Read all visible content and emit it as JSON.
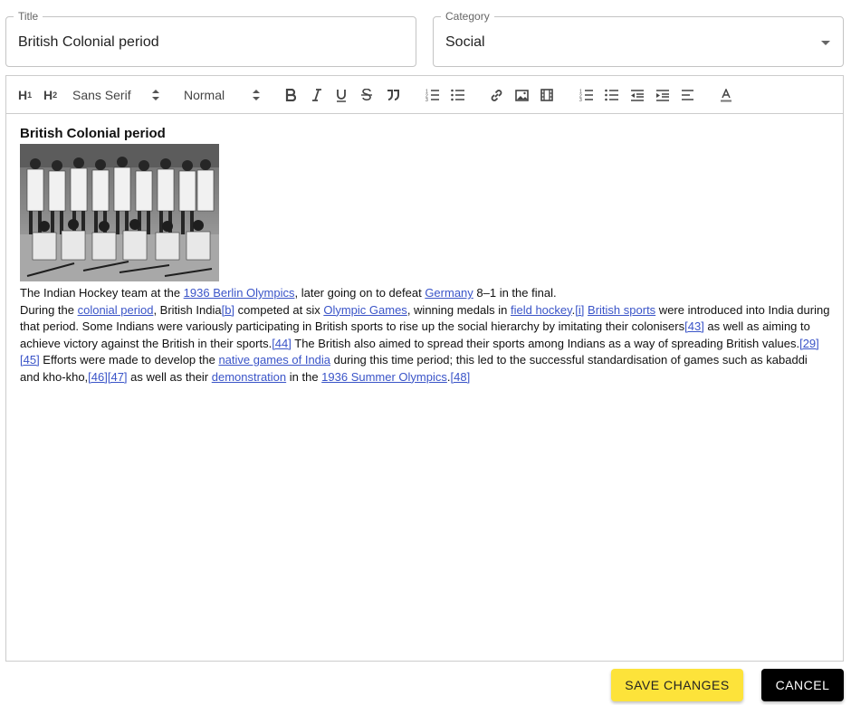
{
  "form": {
    "title_label": "Title",
    "title_value": "British Colonial period",
    "category_label": "Category",
    "category_value": "Social"
  },
  "toolbar": {
    "h1": "H",
    "h1_sub": "1",
    "h2": "H",
    "h2_sub": "2",
    "font_picker": "Sans Serif",
    "size_picker": "Normal"
  },
  "content": {
    "heading": "British Colonial period",
    "caption": {
      "t1": "The Indian Hockey team at the ",
      "l1": "1936 Berlin Olympics",
      "t2": ", later going on to defeat ",
      "l2": "Germany",
      "t3": " 8–1 in the final."
    },
    "para": {
      "t1": "During the ",
      "l_colonial": "colonial period",
      "t2": ", British India",
      "ref_b": "[b]",
      "t3": " competed at six ",
      "l_olympic": "Olympic Games",
      "t4": ", winning medals in ",
      "l_hockey": "field hockey",
      "t5": ".",
      "ref_i": "[i]",
      "t6": " ",
      "l_british": "British sports",
      "t7": " were introduced into India during that period. Some Indians were variously participating in British sports to rise up the social hierarchy by imitating their colonisers",
      "ref_43": "[43]",
      "t8": " as well as aiming to achieve victory against the British in their sports.",
      "ref_44": "[44]",
      "t9": " The British also aimed to spread their sports among Indians as a way of spreading British values.",
      "ref_29": "[29]",
      "ref_45": "[45]",
      "t10": " Efforts were made to develop the ",
      "l_native": "native games of India",
      "t11": " during this time period; this led to the successful standardisation of games such as kabaddi and kho-kho,",
      "ref_46": "[46]",
      "ref_47": "[47]",
      "t12": " as well as their ",
      "l_demo": "demonstration",
      "t13": " in the ",
      "l_1936": "1936 Summer Olympics",
      "t14": ".",
      "ref_48": "[48]"
    }
  },
  "actions": {
    "save": "SAVE CHANGES",
    "cancel": "CANCEL"
  },
  "colors": {
    "save_bg": "#fde33a",
    "cancel_bg": "#000000",
    "link": "#3a54c8"
  }
}
